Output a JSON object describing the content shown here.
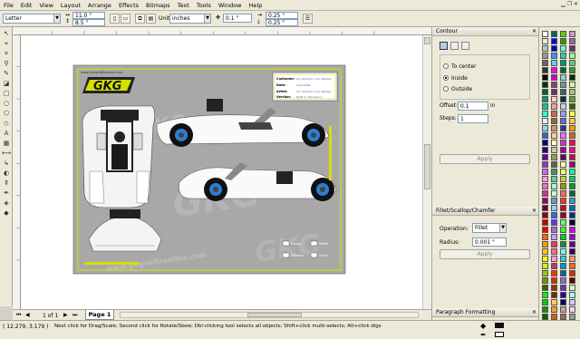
{
  "menu": [
    "File",
    "Edit",
    "View",
    "Layout",
    "Arrange",
    "Effects",
    "Bitmaps",
    "Text",
    "Tools",
    "Window",
    "Help"
  ],
  "property_bar": {
    "paper_size": "Letter",
    "width": "11.0 \"",
    "height": "8.5 \"",
    "units_label": "Units:",
    "units": "inches",
    "nudge": "0.1 \"",
    "dup_x": "0.25 \"",
    "dup_y": "0.25 \""
  },
  "design": {
    "website": "www.karkgrafixonline.com",
    "logo": "GKG",
    "watermark": "www.gkgrafixonline.com",
    "info_box": [
      {
        "label": "Customer:",
        "value": "Lori Stamps / Lori Stamps"
      },
      {
        "label": "Date:",
        "value": "1/21/2009"
      },
      {
        "label": "Artist:",
        "value": "Lori Stamps / Lori Stamps"
      },
      {
        "label": "Version:",
        "value": "Draft 2 / Revision 1"
      }
    ],
    "checkbox_labels": [
      "Glossy",
      "Matte",
      "Chrome",
      "Other"
    ]
  },
  "pages": {
    "counter": "1 of 1",
    "active_tab": "Page 1"
  },
  "status": {
    "coords": "( 12.279, 3.179 )",
    "hint": "Next click for Drag/Scale; Second click for Rotate/Skew; Dbl-clicking tool selects all objects; Shift+click multi-selects; Alt+click digs"
  },
  "contour": {
    "title": "Contour",
    "options": [
      "To center",
      "Inside",
      "Outside"
    ],
    "selected": "Inside",
    "offset_label": "Offset:",
    "offset_value": "0.1",
    "offset_unit": "in",
    "steps_label": "Steps:",
    "steps_value": "1",
    "apply": "Apply"
  },
  "fillet": {
    "title": "Fillet/Scallop/Chamfer",
    "operation_label": "Operation:",
    "operation_value": "Fillet",
    "radius_label": "Radius:",
    "radius_value": "0.001 \"",
    "apply": "Apply"
  },
  "paragraph_docker": {
    "title": "Paragraph Formatting"
  },
  "palette_colors": [
    "#ffffff",
    "#e6e6e6",
    "#c0c0c0",
    "#999999",
    "#666666",
    "#333333",
    "#000000",
    "#003300",
    "#006633",
    "#009966",
    "#00cc99",
    "#33ffcc",
    "#ccffff",
    "#99ccff",
    "#3366cc",
    "#000099",
    "#330066",
    "#660099",
    "#9933cc",
    "#cc66ff",
    "#ff99ff",
    "#ff66cc",
    "#cc3399",
    "#990066",
    "#660033",
    "#990000",
    "#cc0000",
    "#ff0000",
    "#ff6600",
    "#ff9900",
    "#ffcc00",
    "#ffff00",
    "#ccff00",
    "#99cc00",
    "#669900",
    "#336600",
    "#00ff00",
    "#00cc00",
    "#009900",
    "#006600",
    "#00ffff",
    "#00cccc",
    "#009999",
    "#006666",
    "#0000ff",
    "#0000cc",
    "#3399ff",
    "#66ccff",
    "#ff00ff",
    "#cc00cc",
    "#993399",
    "#663366",
    "#ffcccc",
    "#ff9999",
    "#cc6666",
    "#996633",
    "#cc9966",
    "#ffcc99",
    "#ffffcc",
    "#cccc99",
    "#999966",
    "#666633",
    "#339966",
    "#66cc99",
    "#99ffcc",
    "#ccffcc",
    "#6699cc",
    "#99ccff",
    "#3366ff",
    "#6633ff",
    "#9966ff",
    "#cc99ff",
    "#ff3366",
    "#ff6699",
    "#ff99cc",
    "#cc3366",
    "#ff3300",
    "#cc3300",
    "#993300",
    "#663300",
    "#ffcc66",
    "#ff9933",
    "#cc6600",
    "#996600",
    "#ccff66",
    "#99ff33",
    "#66cc00",
    "#339900",
    "#66ffcc",
    "#33cc99",
    "#009966",
    "#006633",
    "#99cccc",
    "#669999",
    "#336666",
    "#003333",
    "#ccccff",
    "#9999ff",
    "#6666cc",
    "#333399",
    "#ff66ff",
    "#cc33cc",
    "#990099",
    "#660066",
    "#ffff99",
    "#ffff66",
    "#cccc33",
    "#999900",
    "#ff6666",
    "#ff3333",
    "#cc0033",
    "#990033",
    "#66ff66",
    "#33ff33",
    "#00cc33",
    "#009933",
    "#66ffff",
    "#33cccc",
    "#0099cc",
    "#006699",
    "#9966cc",
    "#6633cc",
    "#330099",
    "#000066",
    "#cc9999",
    "#996666",
    "#663333",
    "#330000",
    "#ffccff",
    "#cc99cc",
    "#996699",
    "#663366",
    "#99ff99",
    "#66cc66",
    "#339933",
    "#003300",
    "#ccff99",
    "#99cc66",
    "#669933",
    "#336600",
    "#ffff33",
    "#ffcc33",
    "#ff9900",
    "#cc6633",
    "#ff0066",
    "#ff0099",
    "#cc0066",
    "#990066",
    "#00ff99",
    "#00cc66",
    "#009933",
    "#006633",
    "#3399cc",
    "#0066cc",
    "#003399",
    "#000033",
    "#cc00ff",
    "#9900cc",
    "#660099",
    "#330066",
    "#ff9966",
    "#ff6633",
    "#cc3300",
    "#660000",
    "#ccffcc",
    "#99ffff",
    "#ccccff",
    "#ffccff",
    "#999999",
    "#808080",
    "#666666",
    "#4d4d4d"
  ]
}
